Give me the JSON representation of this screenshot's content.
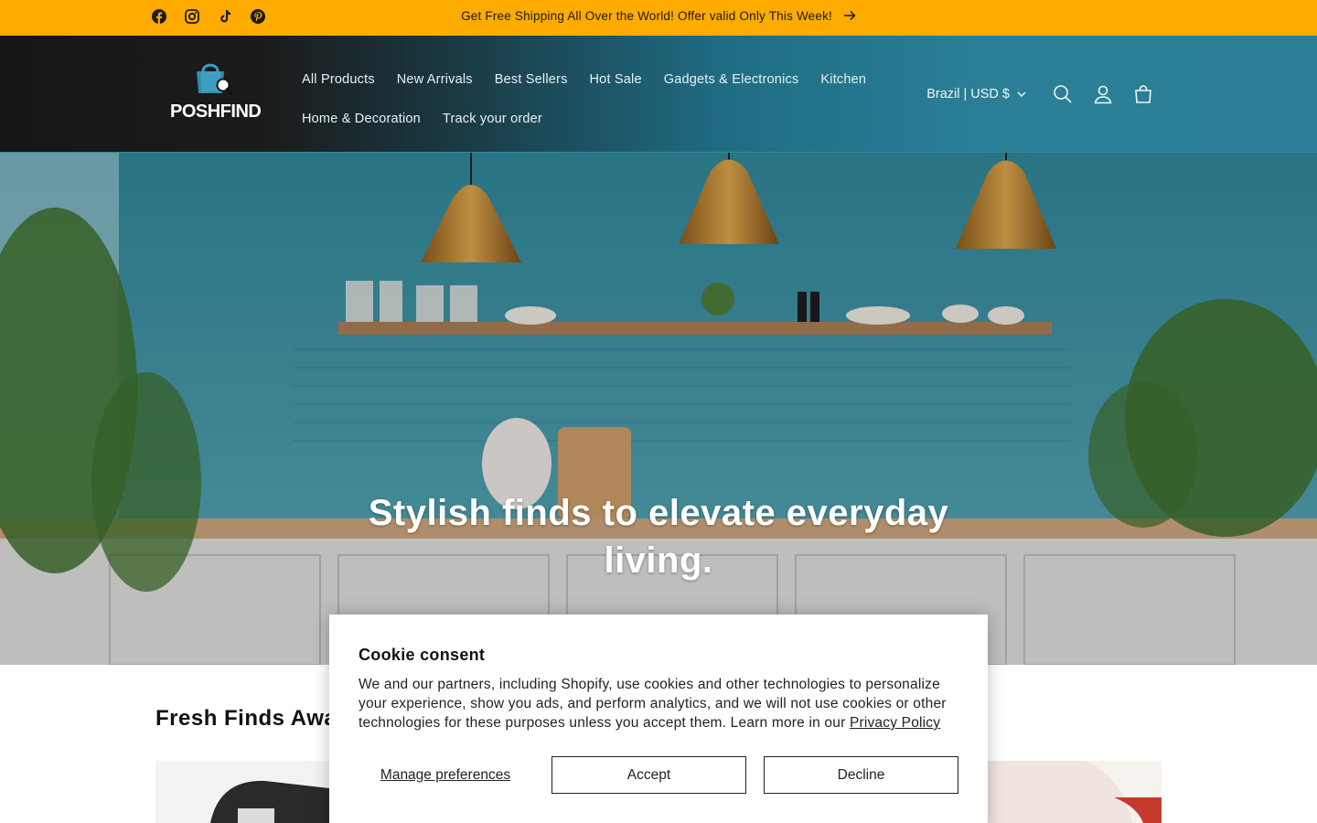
{
  "announcement": {
    "text": "Get Free Shipping All Over the World! Offer valid Only This Week!",
    "social": [
      "facebook-icon",
      "instagram-icon",
      "tiktok-icon",
      "pinterest-icon"
    ],
    "background": "#ffab00"
  },
  "header": {
    "logo_text": "POSHFIND",
    "nav_row1": [
      "All Products",
      "New Arrivals",
      "Best Sellers",
      "Hot Sale",
      "Gadgets & Electronics",
      "Kitchen"
    ],
    "nav_row2": [
      "Home & Decoration",
      "Track your order"
    ],
    "country_selector": "Brazil | USD $",
    "icons": [
      "search-icon",
      "account-icon",
      "cart-icon"
    ]
  },
  "hero": {
    "title": "Stylish finds to elevate everyday living."
  },
  "section": {
    "title": "Fresh Finds Awaits"
  },
  "cookie": {
    "title": "Cookie consent",
    "body": "We and our partners, including Shopify, use cookies and other technologies to personalize your experience, show you ads, and perform analytics, and we will not use cookies or other technologies for these purposes unless you accept them. Learn more in our ",
    "link": "Privacy Policy",
    "manage_label": "Manage preferences",
    "accept_label": "Accept",
    "decline_label": "Decline"
  },
  "colors": {
    "accent": "#ffab00",
    "header_teal": "#2b7e95",
    "header_dark": "#161616"
  }
}
